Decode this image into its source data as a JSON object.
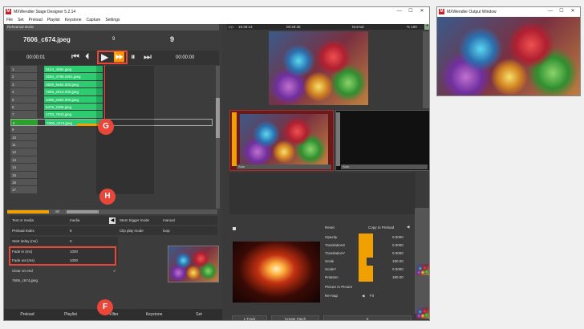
{
  "designer": {
    "title": "MXWendler Stage Designer 5.2.14",
    "menu": [
      "File",
      "Set",
      "Preload",
      "Playlist",
      "Keystone",
      "Capture",
      "Settings"
    ],
    "mode": "Rehearsal Mode",
    "file": "7606_c674.jpeg",
    "count_a": "9",
    "count_b": "9",
    "time_left": "00:00:01",
    "time_right": "00:00:00"
  },
  "playlist": {
    "rows": [
      {
        "n": "1",
        "name": "0124_4b92.jpeg"
      },
      {
        "n": "2",
        "name": "0264_4795.2901.jpeg"
      },
      {
        "n": "3",
        "name": "0929_6e64.300.jpeg"
      },
      {
        "n": "4",
        "name": "7606_2913.300.jpeg"
      },
      {
        "n": "5",
        "name": "3499_e682.300.jpeg"
      },
      {
        "n": "6",
        "name": "5476_2305.jpeg"
      },
      {
        "n": "7",
        "name": "4703_7843.jpeg"
      },
      {
        "n": "8",
        "name": "7606_c674.jpeg"
      },
      {
        "n": "9",
        "name": ""
      },
      {
        "n": "10",
        "name": ""
      },
      {
        "n": "11",
        "name": ""
      },
      {
        "n": "12",
        "name": ""
      },
      {
        "n": "13",
        "name": ""
      },
      {
        "n": "14",
        "name": ""
      },
      {
        "n": "15",
        "name": ""
      },
      {
        "n": "16",
        "name": ""
      },
      {
        "n": "17",
        "name": ""
      }
    ]
  },
  "props": {
    "text_or_media": "Text or media",
    "text_or_media_val": "media",
    "preload_index": "Preload Index",
    "preload_index_val": "8",
    "start_delay": "Start delay (ms)",
    "start_delay_val": "0",
    "fade_in": "Fade in (ms)",
    "fade_in_val": "1000",
    "fade_out": "Fade out (ms)",
    "fade_out_val": "1000",
    "clear_on_end": "Clear on end",
    "filename": "7606_c674.jpeg",
    "stem_trigger": "Stem trigger mode",
    "stem_trigger_val": "manual",
    "clip_play": "Clip play mode",
    "clip_play_val": "loop"
  },
  "tabs": [
    "Preload",
    "Playlist",
    "Filter",
    "Keystone",
    "Set"
  ],
  "scroll_label": "x8",
  "mixer": {
    "time_a": "15:28:13",
    "time_b": "00:28:35",
    "blend": "Normal",
    "percent": "% 100",
    "layer_a": "Solo",
    "layer_b": "Solo",
    "add_track": "1 Track",
    "create_patch": "Create Patch",
    "x_label": "X"
  },
  "fx": {
    "reset": "Reset",
    "copy": "Copy to Preload",
    "params": [
      {
        "name": "Opacity",
        "val": "0.0000"
      },
      {
        "name": "TranslationX",
        "val": "0.0000"
      },
      {
        "name": "TranslationY",
        "val": "0.0000"
      },
      {
        "name": "Scale",
        "val": "100.00"
      },
      {
        "name": "ScaleY",
        "val": "0.0000"
      },
      {
        "name": "Rotation",
        "val": "180.00"
      }
    ],
    "pip": "Picture In Picture",
    "remap": "Re-map",
    "fit": "Fit"
  },
  "output": {
    "title": "MXWendler Output Window"
  },
  "markers": {
    "g": "G",
    "h": "H",
    "f": "F"
  }
}
